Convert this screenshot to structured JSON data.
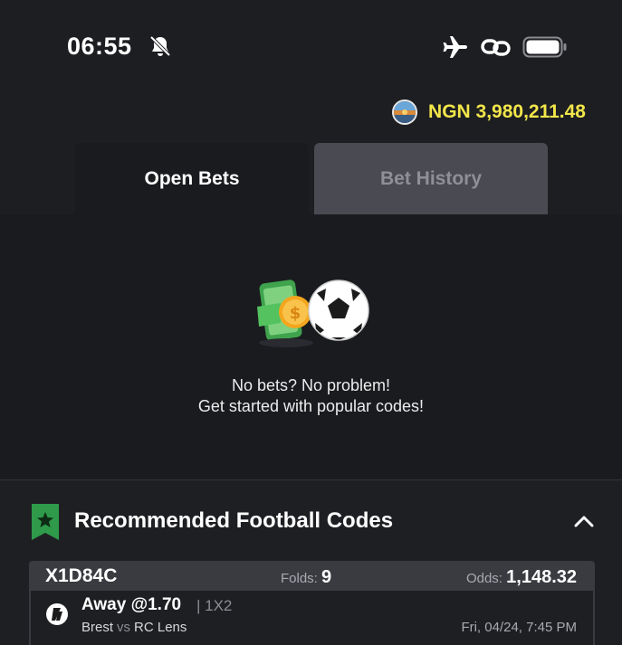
{
  "status_bar": {
    "time": "06:55"
  },
  "balance": {
    "text": "NGN 3,980,211.48"
  },
  "tabs": [
    {
      "label": "Open Bets"
    },
    {
      "label": "Bet History"
    }
  ],
  "empty_state": {
    "line1": "No bets? No problem!",
    "line2": "Get started with popular codes!"
  },
  "recommended": {
    "title": "Recommended Football Codes",
    "code": {
      "id": "X1D84C",
      "folds_label": "Folds:",
      "folds_value": "9",
      "odds_label": "Odds:",
      "odds_value": "1,148.32",
      "bet": {
        "pick": "Away @1.70",
        "market": "| 1X2",
        "home": "Brest",
        "vs": "vs",
        "away": "RC Lens",
        "date": "Fri, 04/24, 7:45 PM"
      }
    }
  },
  "colors": {
    "background": "#1d1e22",
    "balance": "#f2e64a",
    "badge": "#2e9a4a",
    "tab_inactive": "#4a4b52"
  },
  "icons": [
    "bell-off-icon",
    "airplane-icon",
    "link-icon",
    "battery-icon",
    "star-badge-icon",
    "chevron-up-icon",
    "football-icon"
  ]
}
